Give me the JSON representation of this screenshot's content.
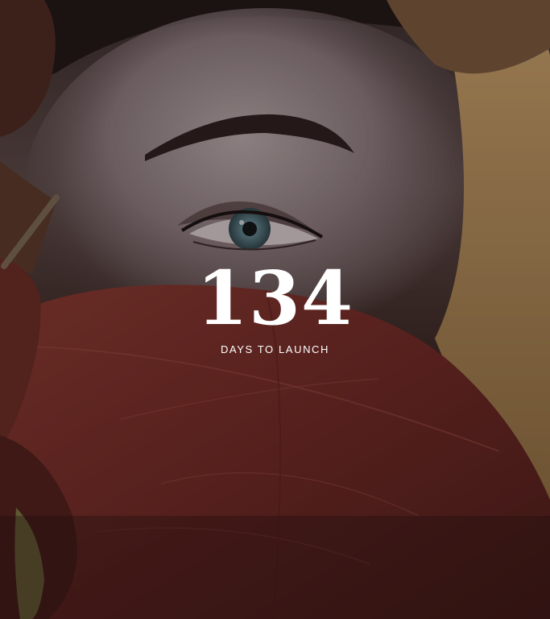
{
  "hero": {
    "background_image": "woman-eye-autumn-leaves-photo",
    "countdown": {
      "number": "134",
      "label": "DAYS TO LAUNCH"
    }
  },
  "colors": {
    "text": "#ffffff",
    "leaf_red": "#7a2f28",
    "leaf_gold": "#c9a36a",
    "skin": "#a89a9b"
  }
}
